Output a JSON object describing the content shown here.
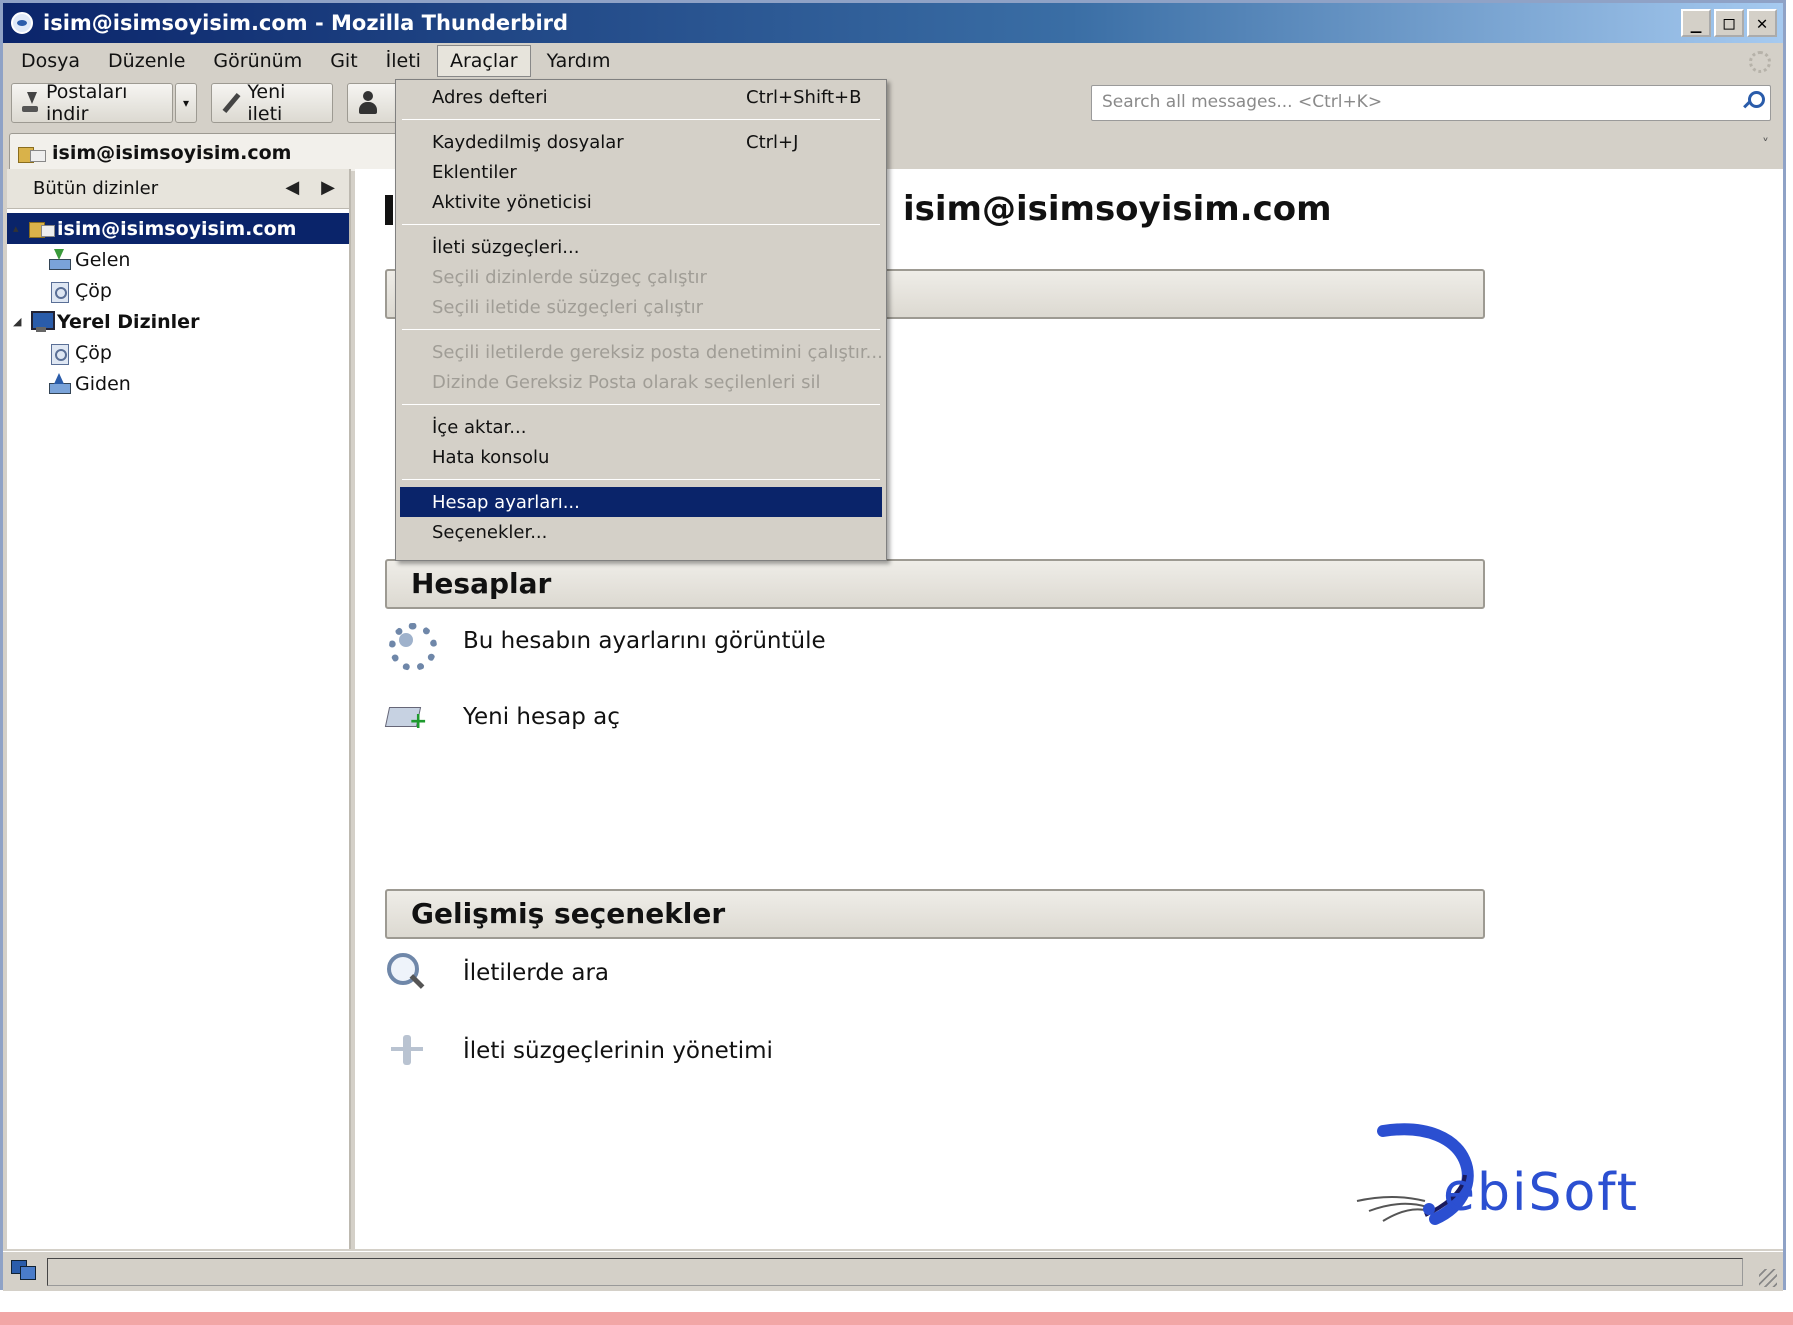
{
  "window": {
    "title": "isim@isimsoyisim.com - Mozilla Thunderbird",
    "controls": {
      "minimize": "_",
      "maximize": "□",
      "close": "✕"
    }
  },
  "menubar": {
    "items": [
      "Dosya",
      "Düzenle",
      "Görünüm",
      "Git",
      "İleti",
      "Araçlar",
      "Yardım"
    ],
    "open_index": 5
  },
  "toolbar": {
    "get_mail_label": "Postaları indir",
    "dropdown_glyph": "▾",
    "new_message_label": "Yeni ileti",
    "search_placeholder": "Search all messages... <Ctrl+K>"
  },
  "tab": {
    "label": "isim@isimsoyisim.com",
    "chevron": "˅"
  },
  "folder_pane": {
    "header": "Bütün dizinler",
    "nav_prev": "◀",
    "nav_next": "▶",
    "tree": [
      {
        "label": "isim@isimsoyisim.com",
        "level": 0,
        "selected": true,
        "twisty": "▴",
        "icon": "account-icon"
      },
      {
        "label": "Gelen",
        "level": 1,
        "icon": "inbox-icon"
      },
      {
        "label": "Çöp",
        "level": 1,
        "icon": "trash-icon"
      },
      {
        "label": "Yerel Dizinler",
        "level": 0,
        "bold": true,
        "twisty": "◢",
        "icon": "computer-icon"
      },
      {
        "label": "Çöp",
        "level": 1,
        "icon": "trash-icon"
      },
      {
        "label": "Giden",
        "level": 1,
        "icon": "outbox-icon"
      }
    ]
  },
  "main": {
    "account_title": "isim@isimsoyisim.com",
    "sections": [
      {
        "title": "Hesaplar",
        "actions": [
          {
            "label": "Bu hesabın ayarlarını görüntüle",
            "icon": "gear-icon"
          },
          {
            "label": "Yeni hesap aç",
            "icon": "new-account-icon"
          }
        ]
      },
      {
        "title": "Gelişmiş seçenekler",
        "actions": [
          {
            "label": "İletilerde ara",
            "icon": "magnifier-icon"
          },
          {
            "label": "İleti süzgeçlerinin yönetimi",
            "icon": "filter-icon"
          }
        ]
      }
    ]
  },
  "tools_menu": {
    "items": [
      {
        "label": "Adres defteri",
        "shortcut": "Ctrl+Shift+B"
      },
      {
        "sep": true
      },
      {
        "label": "Kaydedilmiş dosyalar",
        "shortcut": "Ctrl+J"
      },
      {
        "label": "Eklentiler"
      },
      {
        "label": "Aktivite yöneticisi"
      },
      {
        "sep": true
      },
      {
        "label": "İleti süzgeçleri..."
      },
      {
        "label": "Seçili dizinlerde süzgeç çalıştır",
        "disabled": true
      },
      {
        "label": "Seçili iletide süzgeçleri çalıştır",
        "disabled": true
      },
      {
        "sep": true
      },
      {
        "label": "Seçili iletilerde gereksiz posta denetimini çalıştır...",
        "disabled": true
      },
      {
        "label": "Dizinde Gereksiz Posta olarak seçilenleri sil",
        "disabled": true
      },
      {
        "sep": true
      },
      {
        "label": "İçe aktar..."
      },
      {
        "label": "Hata konsolu"
      },
      {
        "sep": true
      },
      {
        "label": "Hesap ayarları...",
        "highlighted": true
      },
      {
        "label": "Seçenekler..."
      }
    ]
  },
  "logo": {
    "text": "ebiSoft",
    "initial": "D"
  },
  "colors": {
    "titlebar_start": "#0a246a",
    "selection": "#0a246a",
    "logo_blue": "#2b4fd1",
    "bottom_strip": "#f2a6a6"
  }
}
